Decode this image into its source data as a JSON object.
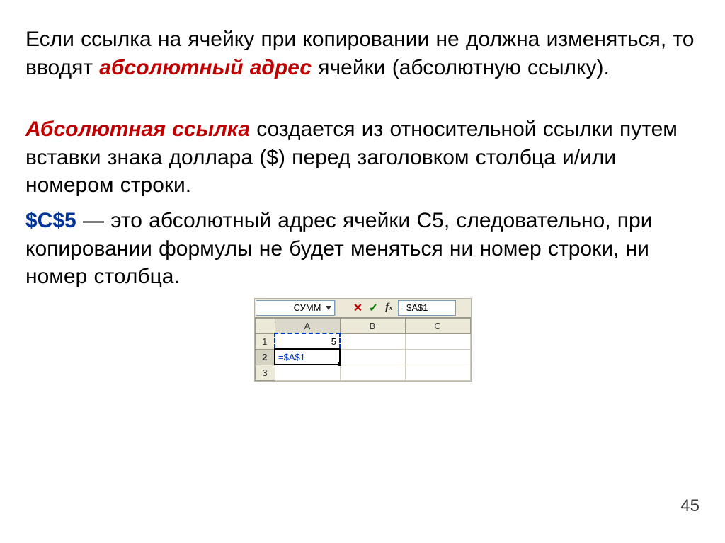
{
  "para1": {
    "pre": "Если ссылка на ячейку при копировании не должна изменяться, то вводят ",
    "emph": "абсолютный адрес",
    "post": " ячейки (абсолютную ссылку)."
  },
  "para2": {
    "emph": "Абсолютная ссылка",
    "post": " создается из относительной ссылки путем вставки знака доллара ($) перед заголовком столбца и/или номером строки."
  },
  "para3": {
    "emph": "$C$5",
    "post": " — это абсолютный адрес ячейки С5, следовательно, при копировании формулы не будет меняться ни номер строки, ни номер столбца."
  },
  "excel": {
    "namebox": "СУММ",
    "formula": "=$A$1",
    "cols": {
      "a": "A",
      "b": "B",
      "c": "C"
    },
    "rows": {
      "r1": "1",
      "r2": "2",
      "r3": "3"
    },
    "cells": {
      "a1": "5",
      "a2": "=$A$1"
    },
    "icons": {
      "cancel": "cancel-x-icon",
      "enter": "enter-check-icon",
      "fx": "fx-icon",
      "dropdown": "dropdown-icon"
    }
  },
  "page_number": "45"
}
